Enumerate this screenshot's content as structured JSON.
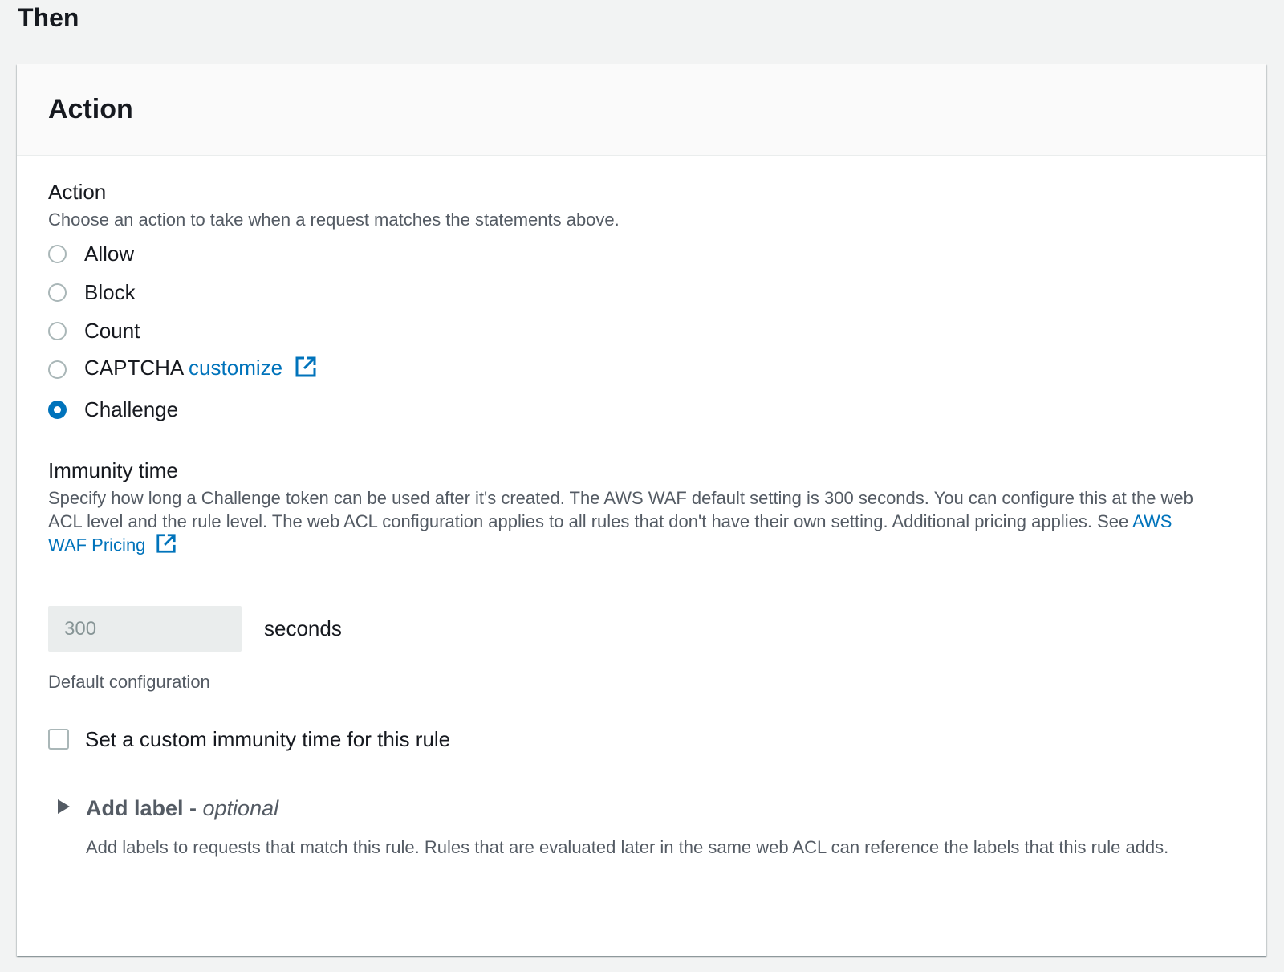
{
  "section": {
    "title": "Then"
  },
  "panel": {
    "header": "Action"
  },
  "action_field": {
    "label": "Action",
    "description": "Choose an action to take when a request matches the statements above.",
    "options": [
      {
        "label": "Allow",
        "selected": false
      },
      {
        "label": "Block",
        "selected": false
      },
      {
        "label": "Count",
        "selected": false
      },
      {
        "label": "CAPTCHA",
        "selected": false,
        "link": "customize"
      },
      {
        "label": "Challenge",
        "selected": true
      }
    ]
  },
  "immunity": {
    "label": "Immunity time",
    "description": "Specify how long a Challenge token can be used after it's created. The AWS WAF default setting is 300 seconds. You can configure this at the web ACL level and the rule level. The web ACL configuration applies to all rules that don't have their own setting. Additional pricing applies. See",
    "link": "AWS WAF Pricing",
    "value": "300",
    "unit": "seconds",
    "default_note": "Default configuration",
    "checkbox_label": "Set a custom immunity time for this rule",
    "checkbox_checked": false
  },
  "add_label": {
    "title": "Add label",
    "separator": " - ",
    "optional": "optional",
    "description": "Add labels to requests that match this rule. Rules that are evaluated later in the same web ACL can reference the labels that this rule adds."
  },
  "colors": {
    "accent": "#0073bb",
    "text": "#16191f",
    "muted": "#545b64",
    "background": "#f2f3f3"
  },
  "icons": [
    "external-link-icon",
    "caret-right-icon"
  ]
}
